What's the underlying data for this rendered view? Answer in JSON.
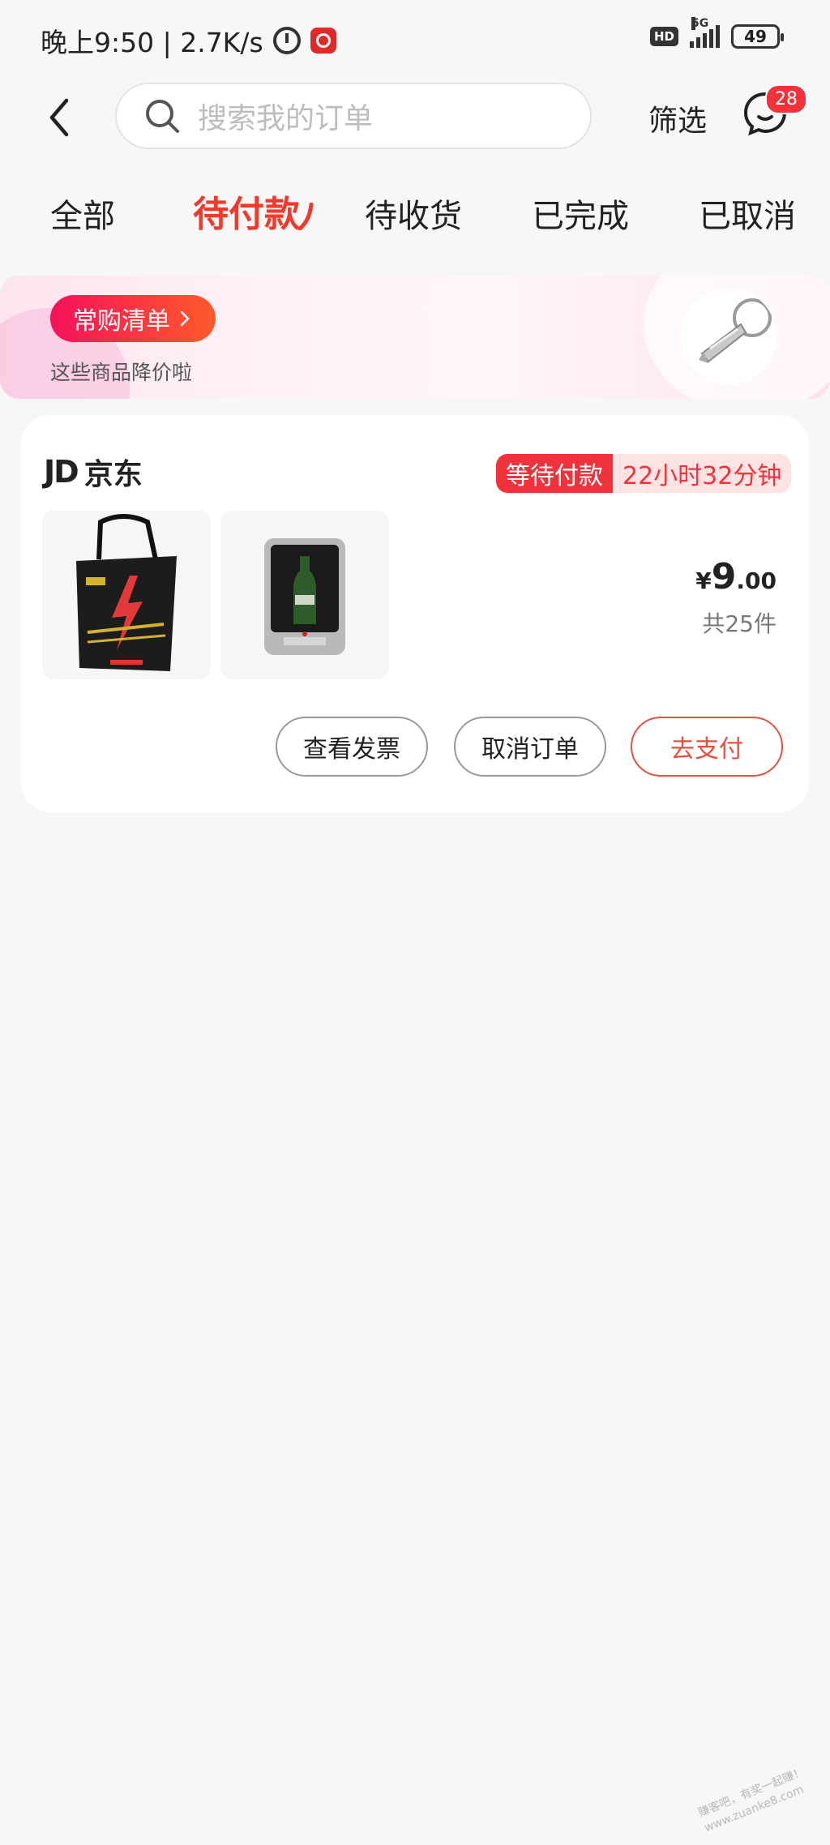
{
  "status_bar": {
    "time_speed": "晚上9:50 | 2.7K/s",
    "hd": "HD",
    "network": "5G",
    "battery": "49"
  },
  "header": {
    "search_placeholder": "搜索我的订单",
    "filter_label": "筛选",
    "message_badge": "28"
  },
  "tabs": [
    "全部",
    "待付款",
    "待收货",
    "已完成",
    "已取消"
  ],
  "active_tab": "待付款",
  "banner": {
    "title": "常购清单",
    "subtitle": "这些商品降价啦"
  },
  "order": {
    "store_logo": "JD",
    "store_name": "京东",
    "status_label": "等待付款",
    "countdown": "22小时32分钟",
    "price_symbol": "¥",
    "price_int": "9",
    "price_dec": ".00",
    "item_count": "共25件",
    "buttons": {
      "invoice": "查看发票",
      "cancel": "取消订单",
      "pay": "去支付"
    }
  },
  "watermark": "赚客吧，有奖一起赚！ www.zuanke8.com",
  "colors": {
    "accent": "#f03a2c",
    "badge": "#f0323c",
    "pay_button": "#e5503f"
  }
}
